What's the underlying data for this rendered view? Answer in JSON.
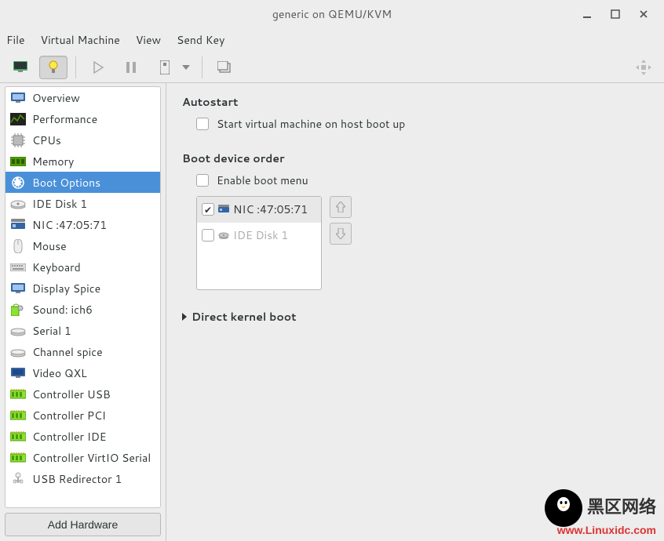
{
  "title": "generic on QEMU/KVM",
  "menu": [
    "File",
    "Virtual Machine",
    "View",
    "Send Key"
  ],
  "sidebar": {
    "items": [
      {
        "label": "Overview"
      },
      {
        "label": "Performance"
      },
      {
        "label": "CPUs"
      },
      {
        "label": "Memory"
      },
      {
        "label": "Boot Options",
        "selected": true
      },
      {
        "label": "IDE Disk 1"
      },
      {
        "label": "NIC :47:05:71"
      },
      {
        "label": "Mouse"
      },
      {
        "label": "Keyboard"
      },
      {
        "label": "Display Spice"
      },
      {
        "label": "Sound: ich6"
      },
      {
        "label": "Serial 1"
      },
      {
        "label": "Channel spice"
      },
      {
        "label": "Video QXL"
      },
      {
        "label": "Controller USB"
      },
      {
        "label": "Controller PCI"
      },
      {
        "label": "Controller IDE"
      },
      {
        "label": "Controller VirtIO Serial"
      },
      {
        "label": "USB Redirector 1"
      }
    ],
    "add_hardware": "Add Hardware"
  },
  "autostart": {
    "title": "Autostart",
    "checkbox_label": "Start virtual machine on host boot up",
    "checked": false
  },
  "boot_order": {
    "title": "Boot device order",
    "enable_menu_label": "Enable boot menu",
    "enable_menu_checked": false,
    "devices": [
      {
        "label": "NIC :47:05:71",
        "checked": true,
        "selected": true,
        "disabled": false,
        "icon": "nic"
      },
      {
        "label": "IDE Disk 1",
        "checked": false,
        "selected": false,
        "disabled": true,
        "icon": "disk"
      }
    ]
  },
  "kernel": {
    "title": "Direct kernel boot"
  },
  "watermark": {
    "line1": "黑区网络",
    "line2": "www.Linuxidc.com"
  }
}
